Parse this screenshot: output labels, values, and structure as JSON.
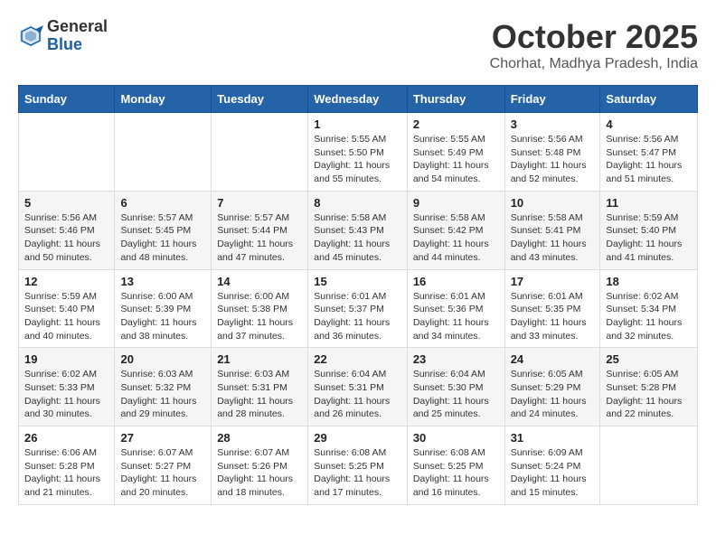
{
  "logo": {
    "general": "General",
    "blue": "Blue"
  },
  "title": "October 2025",
  "location": "Chorhat, Madhya Pradesh, India",
  "days_of_week": [
    "Sunday",
    "Monday",
    "Tuesday",
    "Wednesday",
    "Thursday",
    "Friday",
    "Saturday"
  ],
  "weeks": [
    [
      {
        "day": "",
        "info": ""
      },
      {
        "day": "",
        "info": ""
      },
      {
        "day": "",
        "info": ""
      },
      {
        "day": "1",
        "info": "Sunrise: 5:55 AM\nSunset: 5:50 PM\nDaylight: 11 hours\nand 55 minutes."
      },
      {
        "day": "2",
        "info": "Sunrise: 5:55 AM\nSunset: 5:49 PM\nDaylight: 11 hours\nand 54 minutes."
      },
      {
        "day": "3",
        "info": "Sunrise: 5:56 AM\nSunset: 5:48 PM\nDaylight: 11 hours\nand 52 minutes."
      },
      {
        "day": "4",
        "info": "Sunrise: 5:56 AM\nSunset: 5:47 PM\nDaylight: 11 hours\nand 51 minutes."
      }
    ],
    [
      {
        "day": "5",
        "info": "Sunrise: 5:56 AM\nSunset: 5:46 PM\nDaylight: 11 hours\nand 50 minutes."
      },
      {
        "day": "6",
        "info": "Sunrise: 5:57 AM\nSunset: 5:45 PM\nDaylight: 11 hours\nand 48 minutes."
      },
      {
        "day": "7",
        "info": "Sunrise: 5:57 AM\nSunset: 5:44 PM\nDaylight: 11 hours\nand 47 minutes."
      },
      {
        "day": "8",
        "info": "Sunrise: 5:58 AM\nSunset: 5:43 PM\nDaylight: 11 hours\nand 45 minutes."
      },
      {
        "day": "9",
        "info": "Sunrise: 5:58 AM\nSunset: 5:42 PM\nDaylight: 11 hours\nand 44 minutes."
      },
      {
        "day": "10",
        "info": "Sunrise: 5:58 AM\nSunset: 5:41 PM\nDaylight: 11 hours\nand 43 minutes."
      },
      {
        "day": "11",
        "info": "Sunrise: 5:59 AM\nSunset: 5:40 PM\nDaylight: 11 hours\nand 41 minutes."
      }
    ],
    [
      {
        "day": "12",
        "info": "Sunrise: 5:59 AM\nSunset: 5:40 PM\nDaylight: 11 hours\nand 40 minutes."
      },
      {
        "day": "13",
        "info": "Sunrise: 6:00 AM\nSunset: 5:39 PM\nDaylight: 11 hours\nand 38 minutes."
      },
      {
        "day": "14",
        "info": "Sunrise: 6:00 AM\nSunset: 5:38 PM\nDaylight: 11 hours\nand 37 minutes."
      },
      {
        "day": "15",
        "info": "Sunrise: 6:01 AM\nSunset: 5:37 PM\nDaylight: 11 hours\nand 36 minutes."
      },
      {
        "day": "16",
        "info": "Sunrise: 6:01 AM\nSunset: 5:36 PM\nDaylight: 11 hours\nand 34 minutes."
      },
      {
        "day": "17",
        "info": "Sunrise: 6:01 AM\nSunset: 5:35 PM\nDaylight: 11 hours\nand 33 minutes."
      },
      {
        "day": "18",
        "info": "Sunrise: 6:02 AM\nSunset: 5:34 PM\nDaylight: 11 hours\nand 32 minutes."
      }
    ],
    [
      {
        "day": "19",
        "info": "Sunrise: 6:02 AM\nSunset: 5:33 PM\nDaylight: 11 hours\nand 30 minutes."
      },
      {
        "day": "20",
        "info": "Sunrise: 6:03 AM\nSunset: 5:32 PM\nDaylight: 11 hours\nand 29 minutes."
      },
      {
        "day": "21",
        "info": "Sunrise: 6:03 AM\nSunset: 5:31 PM\nDaylight: 11 hours\nand 28 minutes."
      },
      {
        "day": "22",
        "info": "Sunrise: 6:04 AM\nSunset: 5:31 PM\nDaylight: 11 hours\nand 26 minutes."
      },
      {
        "day": "23",
        "info": "Sunrise: 6:04 AM\nSunset: 5:30 PM\nDaylight: 11 hours\nand 25 minutes."
      },
      {
        "day": "24",
        "info": "Sunrise: 6:05 AM\nSunset: 5:29 PM\nDaylight: 11 hours\nand 24 minutes."
      },
      {
        "day": "25",
        "info": "Sunrise: 6:05 AM\nSunset: 5:28 PM\nDaylight: 11 hours\nand 22 minutes."
      }
    ],
    [
      {
        "day": "26",
        "info": "Sunrise: 6:06 AM\nSunset: 5:28 PM\nDaylight: 11 hours\nand 21 minutes."
      },
      {
        "day": "27",
        "info": "Sunrise: 6:07 AM\nSunset: 5:27 PM\nDaylight: 11 hours\nand 20 minutes."
      },
      {
        "day": "28",
        "info": "Sunrise: 6:07 AM\nSunset: 5:26 PM\nDaylight: 11 hours\nand 18 minutes."
      },
      {
        "day": "29",
        "info": "Sunrise: 6:08 AM\nSunset: 5:25 PM\nDaylight: 11 hours\nand 17 minutes."
      },
      {
        "day": "30",
        "info": "Sunrise: 6:08 AM\nSunset: 5:25 PM\nDaylight: 11 hours\nand 16 minutes."
      },
      {
        "day": "31",
        "info": "Sunrise: 6:09 AM\nSunset: 5:24 PM\nDaylight: 11 hours\nand 15 minutes."
      },
      {
        "day": "",
        "info": ""
      }
    ]
  ]
}
